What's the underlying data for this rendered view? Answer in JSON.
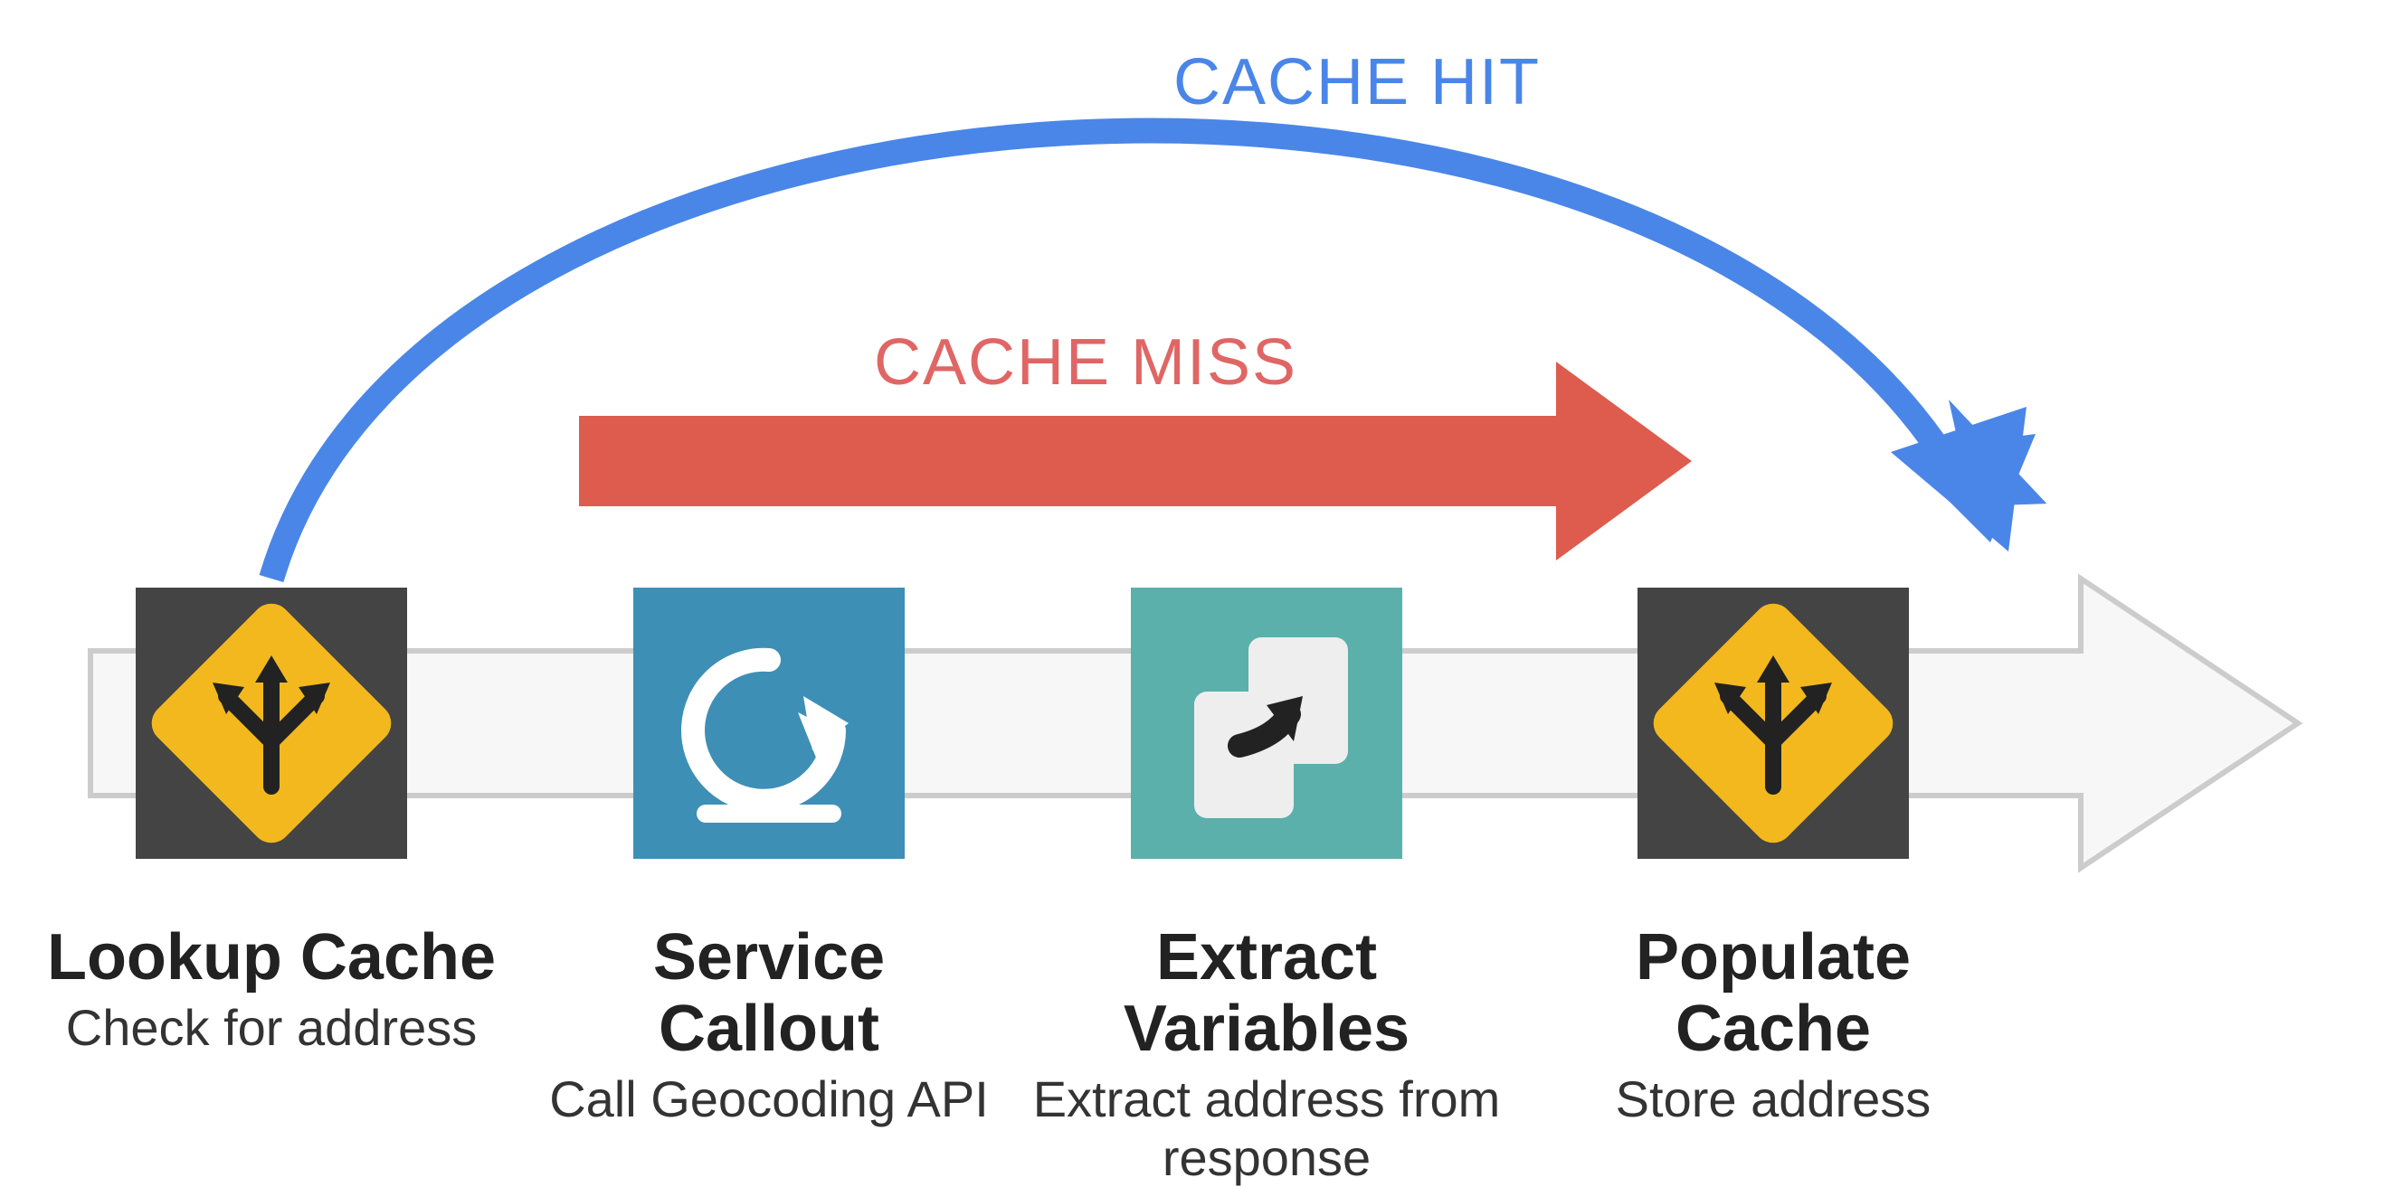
{
  "labels": {
    "cache_hit": "CACHE HIT",
    "cache_miss": "CACHE MISS"
  },
  "steps": {
    "lookup": {
      "title": "Lookup Cache",
      "sub": "Check for address"
    },
    "service": {
      "title": "Service Callout",
      "sub": "Call Geocoding API"
    },
    "extract": {
      "title": "Extract Variables",
      "sub": "Extract address from response"
    },
    "populate": {
      "title": "Populate Cache",
      "sub": "Store address"
    }
  },
  "colors": {
    "blue": "#4a86e8",
    "red": "#dd5c4e",
    "dark": "#444444",
    "yellow": "#f3b81e",
    "steelblue": "#3e8fb6",
    "teal": "#5bb0ab",
    "arrow_fill": "#f7f7f7",
    "arrow_stroke": "#cccccc"
  }
}
